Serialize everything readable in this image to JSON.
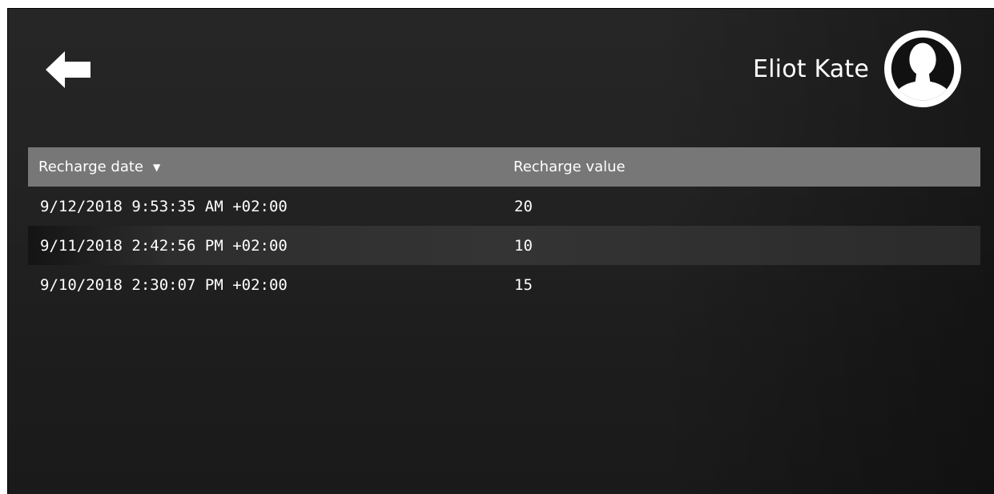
{
  "header": {
    "back_icon": "arrow-left-icon",
    "user": {
      "name": "Eliot Kate",
      "avatar_icon": "user-avatar-icon"
    }
  },
  "table": {
    "columns": [
      {
        "label": "Recharge date",
        "sort": "descending",
        "sort_icon": "sort-down-icon"
      },
      {
        "label": "Recharge value"
      }
    ],
    "rows": [
      {
        "date": "9/12/2018 9:53:35 AM +02:00",
        "value": "20"
      },
      {
        "date": "9/11/2018 2:42:56 PM +02:00",
        "value": "10"
      },
      {
        "date": "9/10/2018 2:30:07 PM +02:00",
        "value": "15"
      }
    ]
  },
  "colors": {
    "background": "#222222",
    "header_row": "#777777",
    "alt_row": "#343434",
    "text": "#ffffff"
  }
}
